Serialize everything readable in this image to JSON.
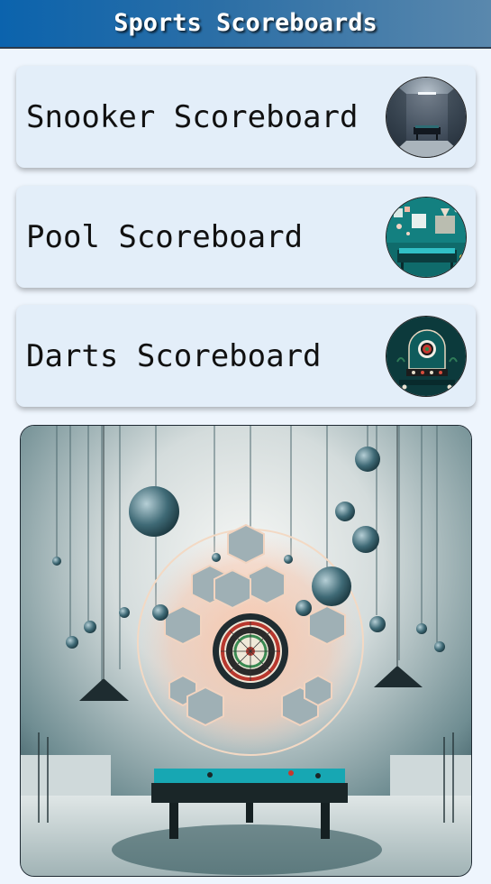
{
  "header": {
    "title": "Sports Scoreboards"
  },
  "menu": {
    "items": [
      {
        "label": "Snooker Scoreboard",
        "thumb_icon": "snooker-room-thumbnail-icon"
      },
      {
        "label": "Pool Scoreboard",
        "thumb_icon": "pool-room-thumbnail-icon"
      },
      {
        "label": "Darts Scoreboard",
        "thumb_icon": "darts-room-thumbnail-icon"
      }
    ]
  },
  "hero": {
    "image_icon": "darts-and-pool-room-illustration"
  },
  "colors": {
    "header_start": "#0b63ad",
    "header_end": "#5a88ad",
    "page_background": "#eef5fd",
    "card_background": "#e3eef9",
    "label_text": "#111111",
    "table_felt": "#17a7b3"
  }
}
